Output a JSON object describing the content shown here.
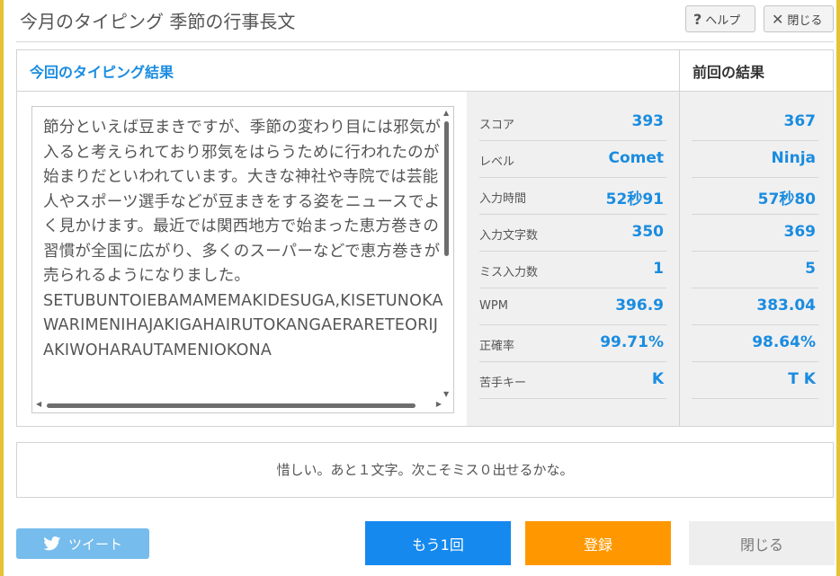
{
  "window": {
    "title": "今月のタイピング 季節の行事長文",
    "help_label": "ヘルプ",
    "close_label": "閉じる"
  },
  "result_panel": {
    "current_heading": "今回のタイピング結果",
    "previous_heading": "前回の結果",
    "typed_text": "節分といえば豆まきですが、季節の変わり目には邪気が入ると考えられており邪気をはらうために行われたのが始まりだといわれています。大きな神社や寺院では芸能人やスポーツ選手などが豆まきをする姿をニュースでよく見かけます。最近では関西地方で始まった恵方巻きの習慣が全国に広がり、多くのスーパーなどで恵方巻きが売られるようになりました。\nSETUBUNTOIEBAMAMEMAKIDESUGA,KISETUNOKAWARIMENIHAJAKIGAHAIRUTOKANGAERARETEORIJAKIWOHARAUTAMENIOKONA",
    "stats": [
      {
        "label": "スコア",
        "current": "393",
        "previous": "367"
      },
      {
        "label": "レベル",
        "current": "Comet",
        "previous": "Ninja"
      },
      {
        "label": "入力時間",
        "current": "52秒91",
        "previous": "57秒80"
      },
      {
        "label": "入力文字数",
        "current": "350",
        "previous": "369"
      },
      {
        "label": "ミス入力数",
        "current": "1",
        "previous": "5"
      },
      {
        "label": "WPM",
        "current": "396.9",
        "previous": "383.04"
      },
      {
        "label": "正確率",
        "current": "99.71%",
        "previous": "98.64%"
      },
      {
        "label": "苦手キー",
        "current": "K",
        "previous": "T K"
      }
    ]
  },
  "message": "惜しい。あと１文字。次こそミス０出せるかな。",
  "buttons": {
    "tweet": "ツイート",
    "retry": "もう1回",
    "register": "登録",
    "close": "閉じる"
  },
  "colors": {
    "accent": "#1a8ce0",
    "retry": "#1589ee",
    "register": "#ff9800",
    "tweet": "#76bcec"
  },
  "icons": {
    "help": "question-mark-icon",
    "close": "x-icon",
    "tweet": "twitter-bird-icon"
  }
}
